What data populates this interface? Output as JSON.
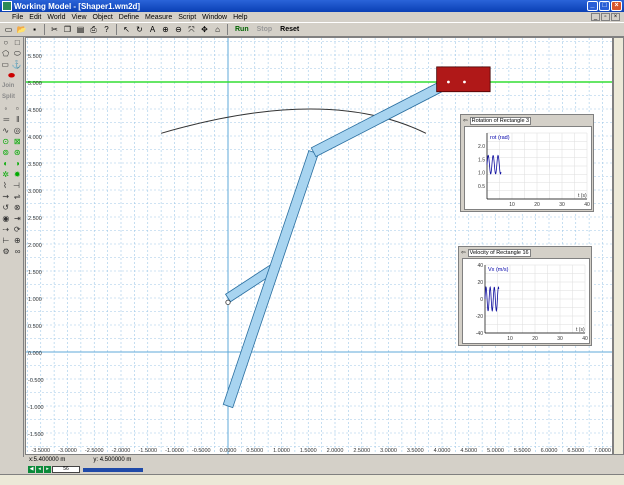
{
  "window": {
    "title": "Working Model - [Shaper1.wm2d]"
  },
  "menu": [
    "File",
    "Edit",
    "World",
    "View",
    "Object",
    "Define",
    "Measure",
    "Script",
    "Window",
    "Help"
  ],
  "toolbar": {
    "run": "Run",
    "stop": "Stop",
    "reset": "Reset"
  },
  "palette": {
    "join": "Join",
    "split": "Split"
  },
  "canvas": {
    "y_ticks": [
      "5.500",
      "5.000",
      "4.500",
      "4.000",
      "3.500",
      "3.000",
      "2.500",
      "2.000",
      "1.500",
      "1.000",
      "0.500",
      "0.000",
      "-0.500",
      "-1.000",
      "-1.500"
    ],
    "x_ticks": [
      "-3.5000",
      "-3.0000",
      "-2.5000",
      "-2.0000",
      "-1.5000",
      "-1.0000",
      "-0.5000",
      "0.0000",
      "0.5000",
      "1.0000",
      "1.5000",
      "2.0000",
      "2.5000",
      "3.0000",
      "3.5000",
      "4.0000",
      "4.5000",
      "5.0000",
      "5.5000",
      "6.0000",
      "6.5000",
      "7.0000"
    ]
  },
  "meters": [
    {
      "title": "Rotation of Rectangle 3",
      "ylabel": "rot (rad)",
      "xlabel": "t (s)",
      "y_ticks": [
        "2.0",
        "1.5",
        "1.0",
        "0.5"
      ],
      "x_ticks": [
        "10",
        "20",
        "30",
        "40"
      ]
    },
    {
      "title": "Velocity of Rectangle 16",
      "ylabel": "Vx (m/s)",
      "xlabel": "t (s)",
      "y_ticks": [
        "40",
        "20",
        "0",
        "-20",
        "-40"
      ],
      "x_ticks": [
        "10",
        "20",
        "30",
        "40"
      ]
    }
  ],
  "status": {
    "x": "x:5.400000 m",
    "y": "y: 4.500000 m"
  },
  "playback": {
    "frame": "56"
  },
  "colors": {
    "body_fill": "#a8d4f0",
    "block_fill": "#b01818",
    "green_line": "#33dd33",
    "grid": "#9fc8e8"
  }
}
